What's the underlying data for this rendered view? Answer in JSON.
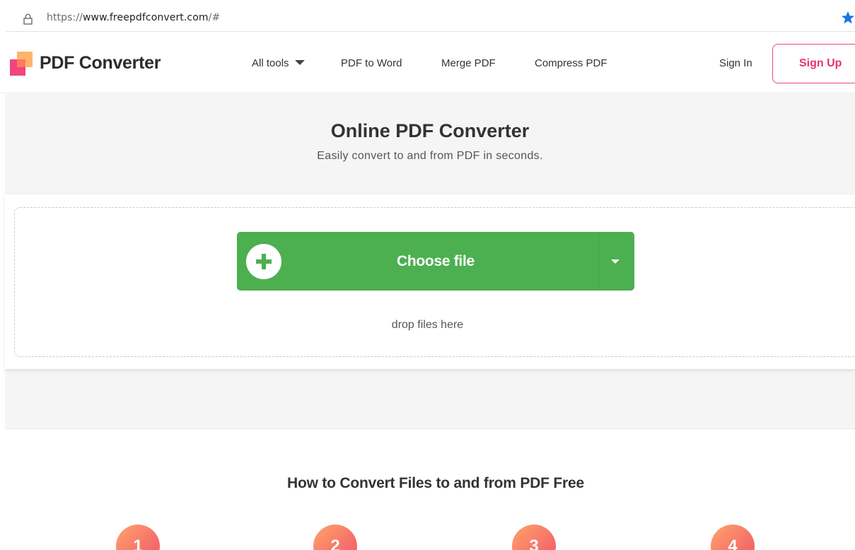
{
  "browser": {
    "url_scheme": "https://",
    "url_host": "www.freepdfconvert.com",
    "url_path": "/#",
    "icons": {
      "lock": "lock-icon",
      "star": "star-icon"
    }
  },
  "header": {
    "brand": "PDF Converter",
    "nav": [
      {
        "label": "All tools"
      },
      {
        "label": "PDF to Word"
      },
      {
        "label": "Merge PDF"
      },
      {
        "label": "Compress PDF"
      }
    ],
    "sign_in": "Sign In",
    "sign_up": "Sign Up",
    "accent_color": "#e8336f"
  },
  "hero": {
    "title": "Online PDF Converter",
    "subtitle": "Easily convert to and from PDF in seconds."
  },
  "upload": {
    "button_label": "Choose file",
    "drop_text": "drop files here",
    "button_color": "#4caf50"
  },
  "howto": {
    "title": "How to Convert Files to and from PDF Free",
    "steps": [
      "1",
      "2",
      "3",
      "4"
    ]
  }
}
